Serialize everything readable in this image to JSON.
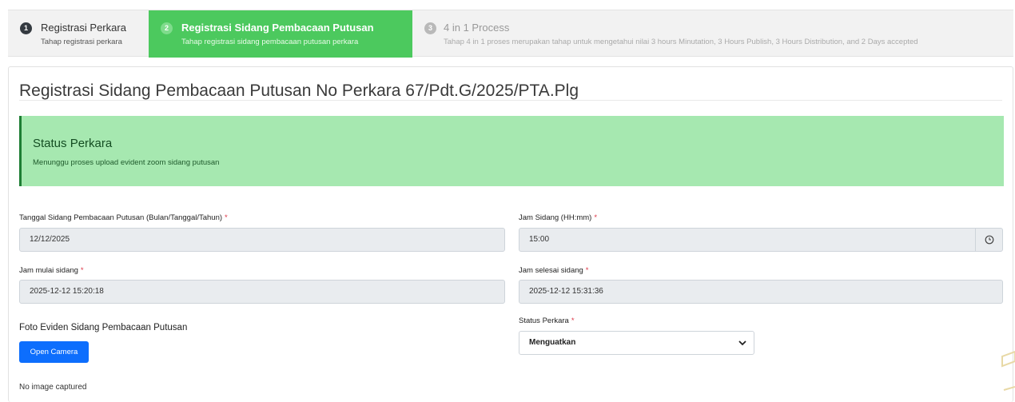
{
  "stepper": {
    "steps": [
      {
        "number": "1",
        "title": "Registrasi Perkara",
        "subtitle": "Tahap registrasi perkara"
      },
      {
        "number": "2",
        "title": "Registrasi Sidang Pembacaan Putusan",
        "subtitle": "Tahap registrasi sidang pembacaan putusan perkara"
      },
      {
        "number": "3",
        "title": "4 in 1 Process",
        "subtitle": "Tahap 4 in 1 proses merupakan tahap untuk mengetahui nilai 3 hours Minutation, 3 Hours Publish, 3 Hours Distribution, and 2 Days accepted"
      }
    ],
    "active_color": "#4cc95e"
  },
  "page": {
    "title": "Registrasi Sidang Pembacaan Putusan No Perkara 67/Pdt.G/2025/PTA.Plg"
  },
  "status_alert": {
    "title": "Status Perkara",
    "text": "Menunggu proses upload evident zoom sidang putusan",
    "background": "#a6e8b0"
  },
  "form": {
    "tanggal_sidang": {
      "label": "Tanggal Sidang Pembacaan Putusan (Bulan/Tanggal/Tahun)",
      "value": "12/12/2025"
    },
    "jam_sidang": {
      "label": "Jam Sidang (HH:mm)",
      "value": "15:00",
      "icon": "clock-icon"
    },
    "jam_mulai": {
      "label": "Jam mulai sidang",
      "value": "2025-12-12 15:20:18"
    },
    "jam_selesai": {
      "label": "Jam selesai sidang",
      "value": "2025-12-12 15:31:36"
    },
    "required_marker": "*",
    "foto_eviden": {
      "label": "Foto Eviden Sidang Pembacaan Putusan",
      "button_label": "Open Camera",
      "no_image_text": "No image captured"
    },
    "status_perkara": {
      "label": "Status Perkara",
      "selected": "Menguatkan",
      "icon": "chevron-down-icon"
    }
  }
}
